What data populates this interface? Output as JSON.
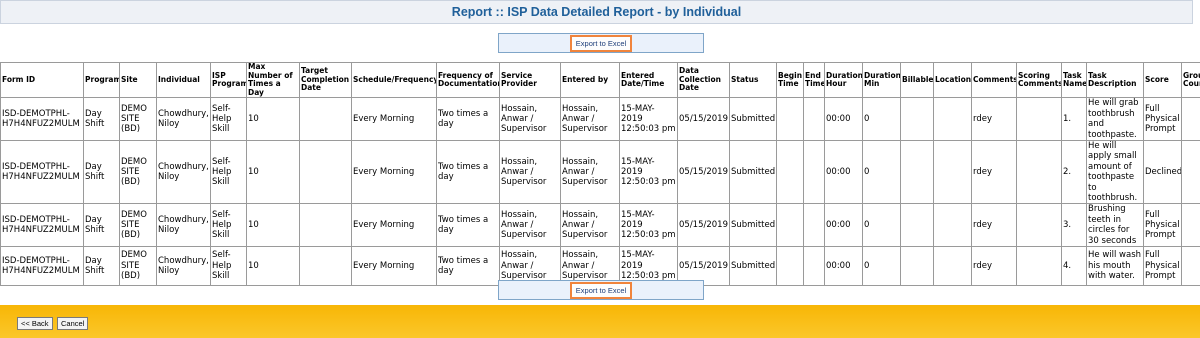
{
  "header": {
    "title": "Report :: ISP Data Detailed Report - by Individual"
  },
  "toolbar": {
    "export_label": "Export to Excel"
  },
  "table": {
    "columns": [
      "Form ID",
      "Program",
      "Site",
      "Individual",
      "ISP Program",
      "Max Number of Times a Day",
      "Target Completion Date",
      "Schedule/Frequency",
      "Frequency of Documentation",
      "Service Provider",
      "Entered by",
      "Entered Date/Time",
      "Data Collection Date",
      "Status",
      "Begin Time",
      "End Time",
      "Duration Hour",
      "Duration Min",
      "Billable",
      "Location",
      "Comments",
      "Scoring Comments",
      "Task Name",
      "Task Description",
      "Score",
      "Group Count"
    ],
    "rows": [
      [
        "ISD-DEMOTPHL-H7H4NFUZ2MULM",
        "Day Shift",
        "DEMO SITE (BD)",
        "Chowdhury, Niloy",
        "Self-Help Skill",
        "10",
        "",
        "Every Morning",
        "Two times a day",
        "Hossain, Anwar / Supervisor",
        "Hossain, Anwar / Supervisor",
        "15-MAY-2019 12:50:03 pm",
        "05/15/2019",
        "Submitted",
        "",
        "",
        "00:00",
        "0",
        "",
        "",
        "rdey",
        "",
        "1.",
        "He will grab toothbrush and toothpaste.",
        "Full Physical Prompt",
        ""
      ],
      [
        "ISD-DEMOTPHL-H7H4NFUZ2MULM",
        "Day Shift",
        "DEMO SITE (BD)",
        "Chowdhury, Niloy",
        "Self-Help Skill",
        "10",
        "",
        "Every Morning",
        "Two times a day",
        "Hossain, Anwar / Supervisor",
        "Hossain, Anwar / Supervisor",
        "15-MAY-2019 12:50:03 pm",
        "05/15/2019",
        "Submitted",
        "",
        "",
        "00:00",
        "0",
        "",
        "",
        "rdey",
        "",
        "2.",
        "He will apply small amount of toothpaste to toothbrush.",
        "Declined",
        ""
      ],
      [
        "ISD-DEMOTPHL-H7H4NFUZ2MULM",
        "Day Shift",
        "DEMO SITE (BD)",
        "Chowdhury, Niloy",
        "Self-Help Skill",
        "10",
        "",
        "Every Morning",
        "Two times a day",
        "Hossain, Anwar / Supervisor",
        "Hossain, Anwar / Supervisor",
        "15-MAY-2019 12:50:03 pm",
        "05/15/2019",
        "Submitted",
        "",
        "",
        "00:00",
        "0",
        "",
        "",
        "rdey",
        "",
        "3.",
        "Brushing teeth in circles for 30 seconds",
        "Full Physical Prompt",
        ""
      ],
      [
        "ISD-DEMOTPHL-H7H4NFUZ2MULM",
        "Day Shift",
        "DEMO SITE (BD)",
        "Chowdhury, Niloy",
        "Self-Help Skill",
        "10",
        "",
        "Every Morning",
        "Two times a day",
        "Hossain, Anwar / Supervisor",
        "Hossain, Anwar / Supervisor",
        "15-MAY-2019 12:50:03 pm",
        "05/15/2019",
        "Submitted",
        "",
        "",
        "00:00",
        "0",
        "",
        "",
        "rdey",
        "",
        "4.",
        "He will wash his mouth with water.",
        "Full Physical Prompt",
        ""
      ]
    ]
  },
  "footer": {
    "back_label": "<< Back",
    "cancel_label": "Cancel"
  },
  "colors": {
    "title_text": "#20609a",
    "footer_bar": "#f8b606",
    "export_border": "#f0843c"
  }
}
